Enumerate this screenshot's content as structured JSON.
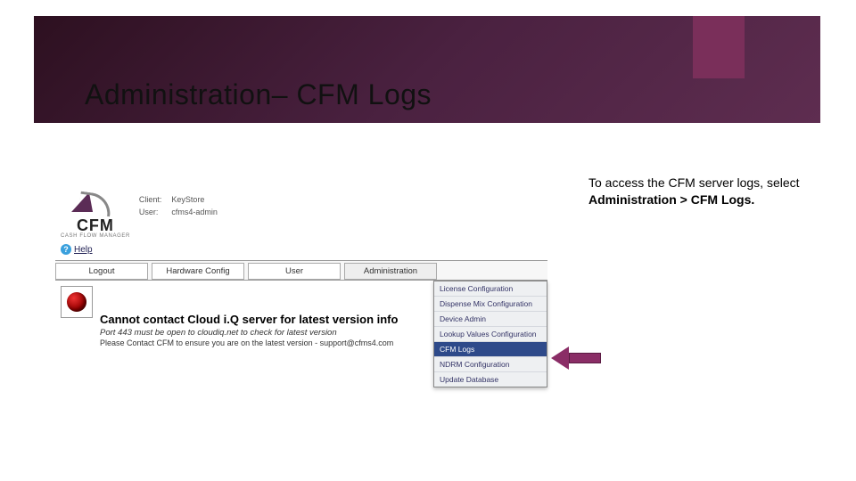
{
  "slide": {
    "title": "Administration– CFM Logs"
  },
  "instruction": {
    "lead": "To access the CFM server logs, select ",
    "bold": "Administration > CFM Logs."
  },
  "app": {
    "logo": {
      "text": "CFM",
      "sub": "CASH FLOW MANAGER"
    },
    "meta": {
      "client_label": "Client:",
      "client_value": "KeyStore",
      "user_label": "User:",
      "user_value": "cfms4-admin"
    },
    "help": {
      "label": "Help"
    },
    "menubar": {
      "logout": "Logout",
      "hardware": "Hardware Config",
      "user": "User",
      "administration": "Administration"
    },
    "dropdown": {
      "items": [
        "License Configuration",
        "Dispense Mix Configuration",
        "Device Admin",
        "Lookup Values Configuration",
        "CFM Logs",
        "NDRM Configuration",
        "Update Database"
      ]
    },
    "messages": {
      "main": "Cannot contact Cloud i.Q server for latest version info",
      "sub1": "Port 443 must be open to cloudiq.net to check for latest version",
      "sub2": "Please Contact CFM to ensure you are on the latest version - support@cfms4.com"
    }
  }
}
